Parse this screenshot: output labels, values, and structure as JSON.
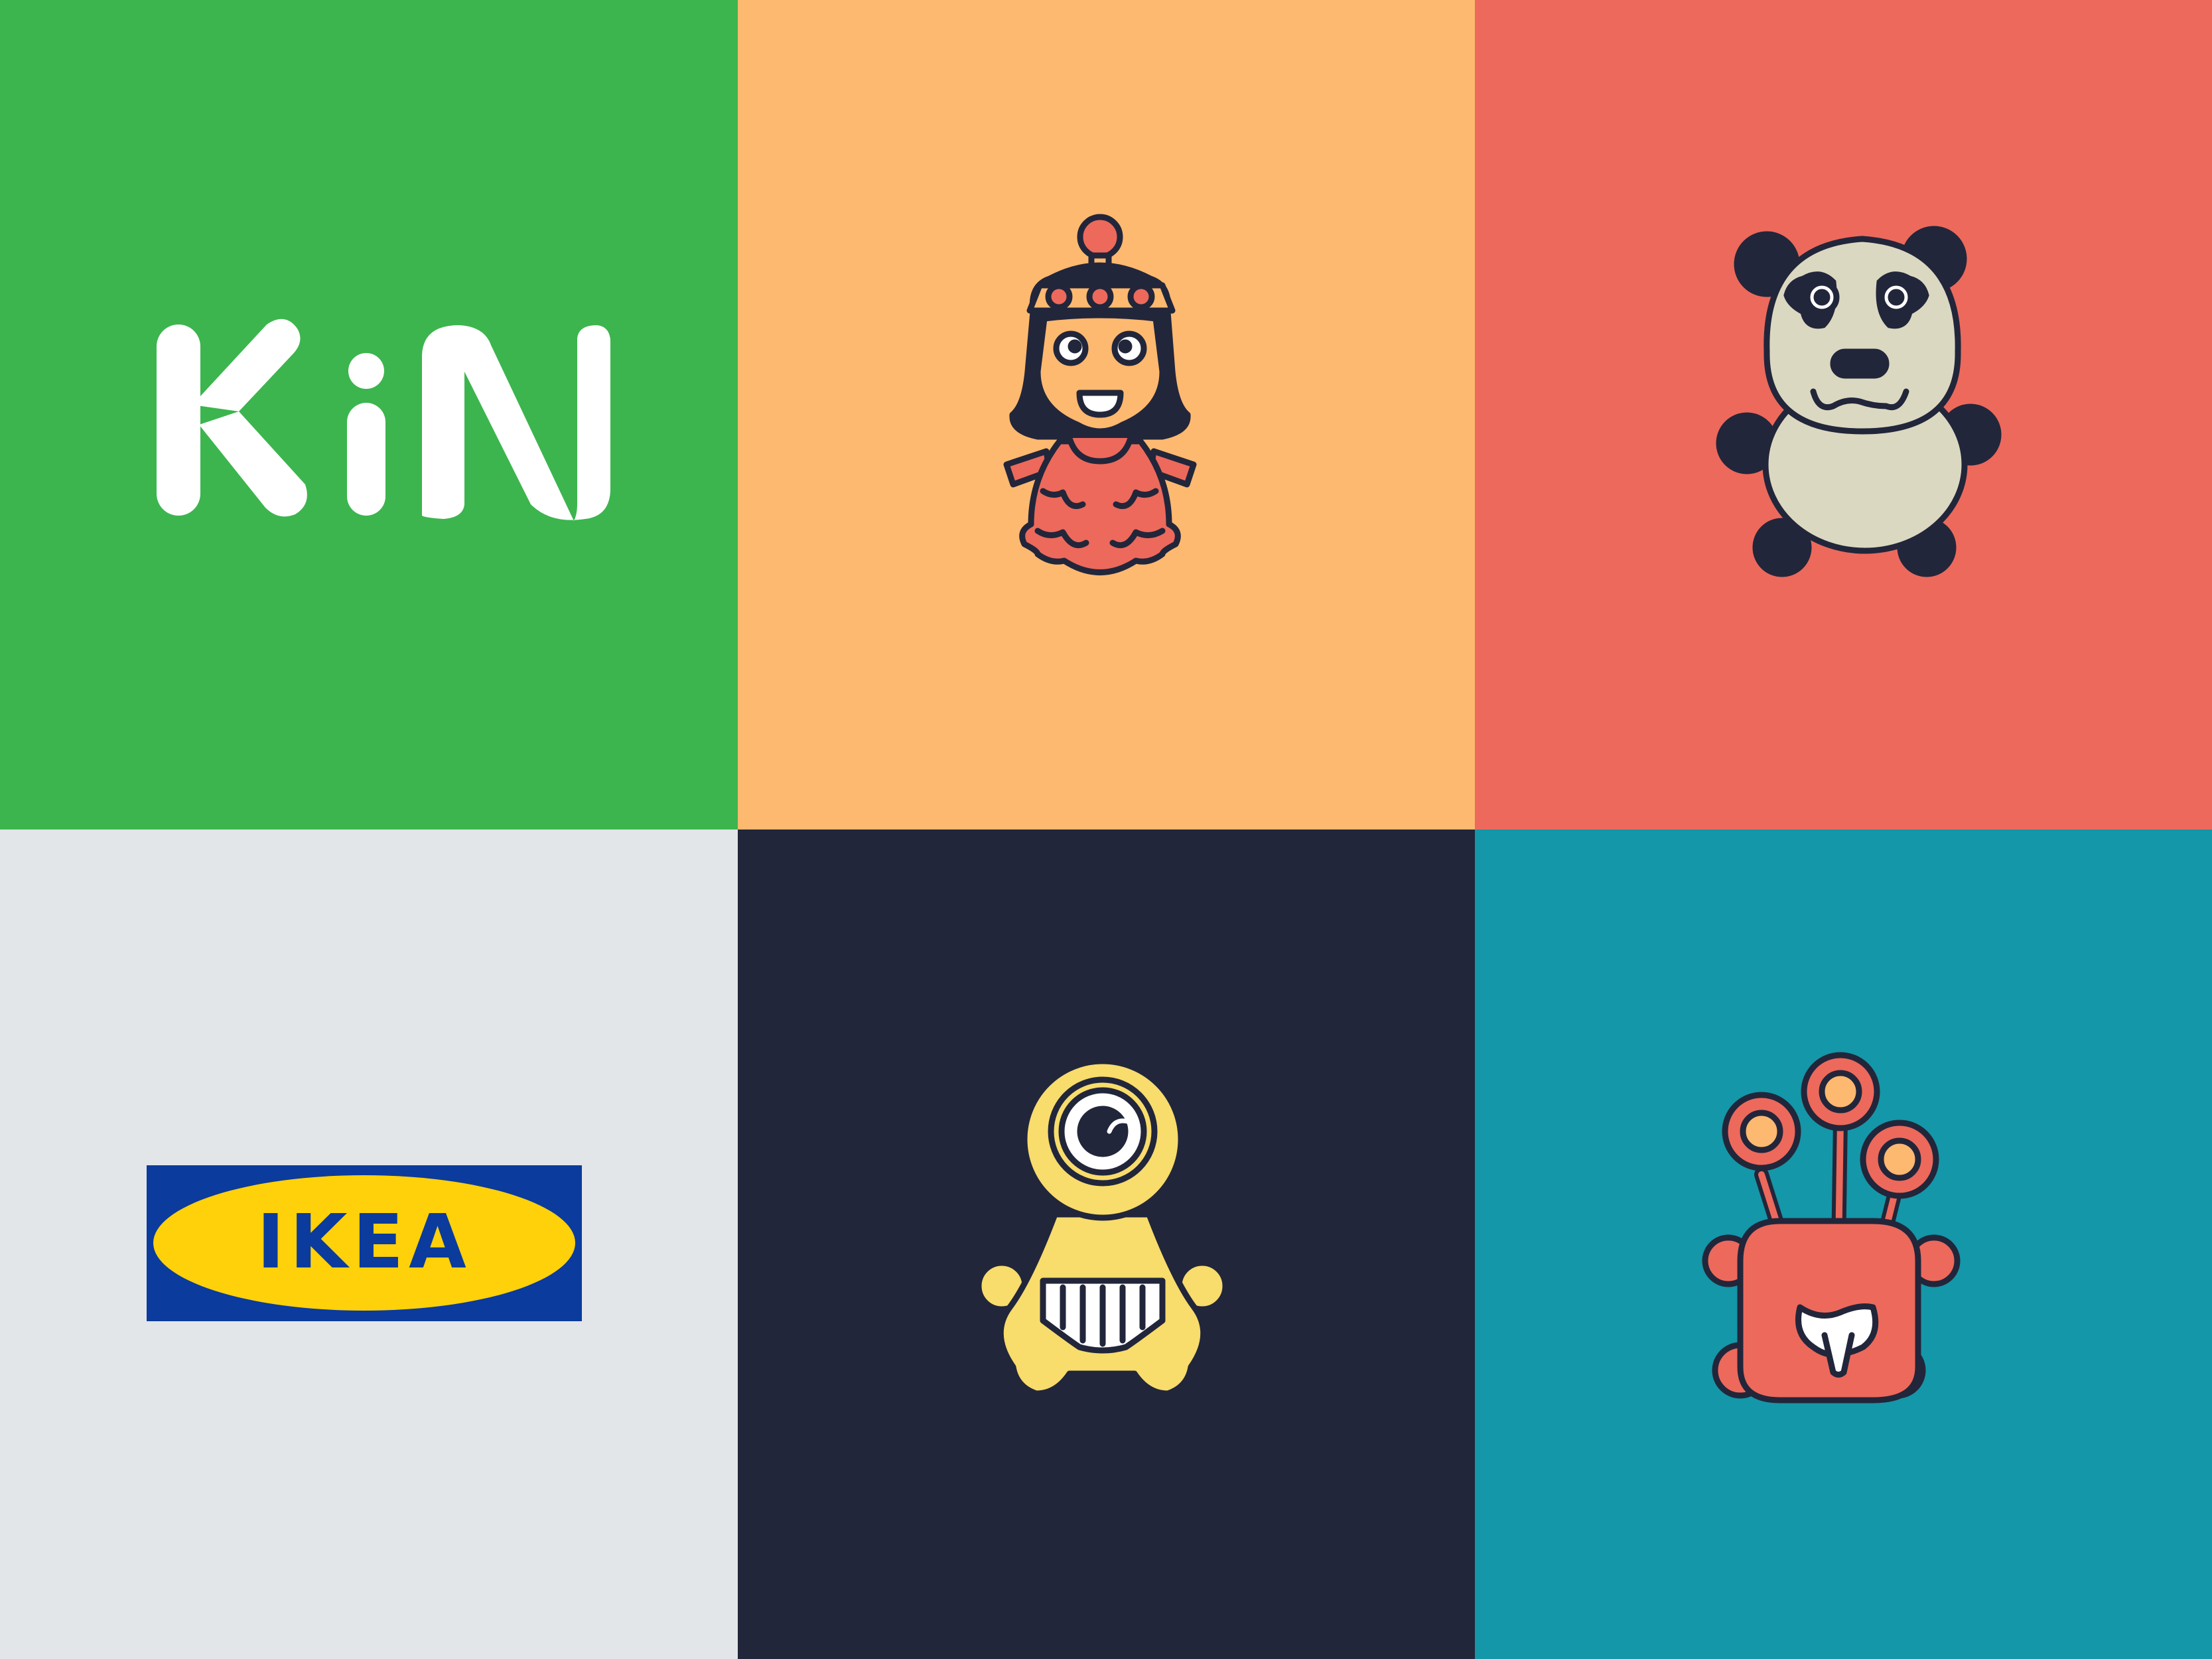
{
  "colors": {
    "green": "#3cb54e",
    "peach": "#feb970",
    "coral": "#ed695b",
    "light_gray": "#e2e6e8",
    "navy": "#22263b",
    "teal": "#1497a8",
    "yellow": "#f8dc6c",
    "cream": "#dbd8c1",
    "ikea_blue": "#0b3b9c",
    "ikea_yellow": "#ffd10a",
    "white": "#ffffff"
  },
  "tiles": [
    {
      "name": "kin-logo",
      "icon": "kin-wordmark"
    },
    {
      "name": "princess-character",
      "icon": "princess-icon"
    },
    {
      "name": "panda-character",
      "icon": "panda-icon"
    },
    {
      "name": "ikea-logo",
      "icon": "ikea-logo"
    },
    {
      "name": "cyclops-character",
      "icon": "cyclops-monster-icon"
    },
    {
      "name": "eyestalk-monster-character",
      "icon": "eyestalk-monster-icon"
    }
  ],
  "logos": {
    "kin_text": "KiN",
    "ikea_text": "IKEA"
  }
}
